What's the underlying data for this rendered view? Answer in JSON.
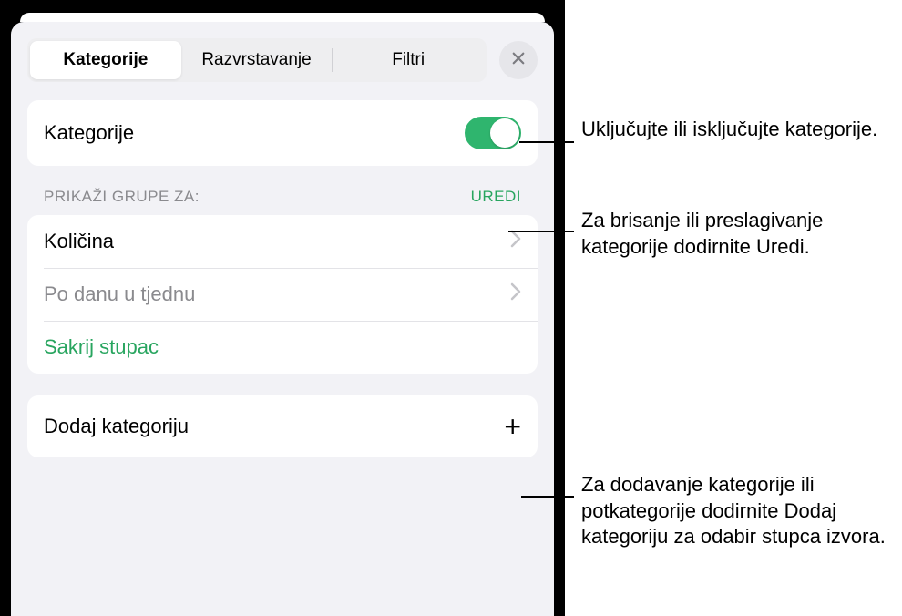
{
  "tabs": {
    "categories": "Kategorije",
    "sorting": "Razvrstavanje",
    "filters": "Filtri"
  },
  "panel": {
    "toggle_label": "Kategorije",
    "section_label": "PRIKAŽI GRUPE ZA:",
    "edit_label": "UREDI",
    "groups": [
      {
        "label": "Količina",
        "dim": false
      },
      {
        "label": "Po danu u tjednu",
        "dim": true
      }
    ],
    "hide_column": "Sakrij stupac",
    "add_category": "Dodaj kategoriju"
  },
  "callouts": {
    "toggle": "Uključujte ili isključujte kategorije.",
    "edit": "Za brisanje ili preslagivanje kategorije dodirnite Uredi.",
    "add": "Za dodavanje kategorije ili potkategorije dodirnite Dodaj kategoriju za odabir stupca izvora."
  }
}
